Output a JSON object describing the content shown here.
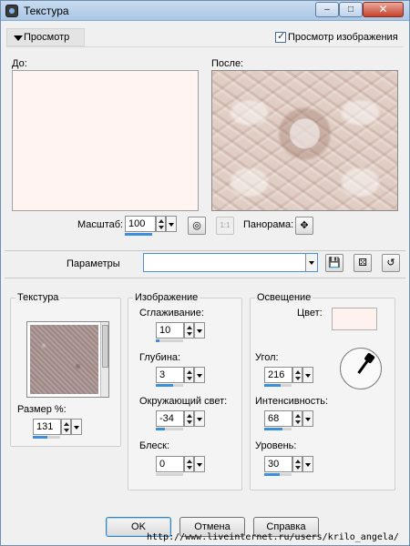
{
  "window": {
    "title": "Текстура",
    "min_icon": "minimize-icon",
    "max_icon": "maximize-icon",
    "close_icon": "close-icon"
  },
  "preview": {
    "toggle_label": "Просмотр",
    "show_preview_label": "Просмотр изображения",
    "show_preview_checked": true,
    "before_label": "До:",
    "after_label": "После:",
    "zoom_label": "Масштаб:",
    "zoom_value": "100",
    "pan_label": "Панорама:",
    "fit_button": "1:1"
  },
  "params": {
    "label": "Параметры",
    "value": ""
  },
  "texture": {
    "title": "Текстура",
    "size_label": "Размер %:",
    "size_value": "131"
  },
  "image": {
    "title": "Изображение",
    "smoothing_label": "Сглаживание:",
    "smoothing_value": "10",
    "depth_label": "Глубина:",
    "depth_value": "3",
    "ambience_label": "Окружающий свет:",
    "ambience_value": "-34",
    "shine_label": "Блеск:",
    "shine_value": "0"
  },
  "lighting": {
    "title": "Освещение",
    "color_label": "Цвет:",
    "color": "#fdf2ee",
    "angle_label": "Угол:",
    "angle_value": "216",
    "intensity_label": "Интенсивность:",
    "intensity_value": "68",
    "level_label": "Уровень:",
    "level_value": "30"
  },
  "buttons": {
    "ok": "OK",
    "cancel": "Отмена",
    "help": "Справка"
  },
  "footer_url": "http://www.liveinternet.ru/users/krilo_angela/"
}
